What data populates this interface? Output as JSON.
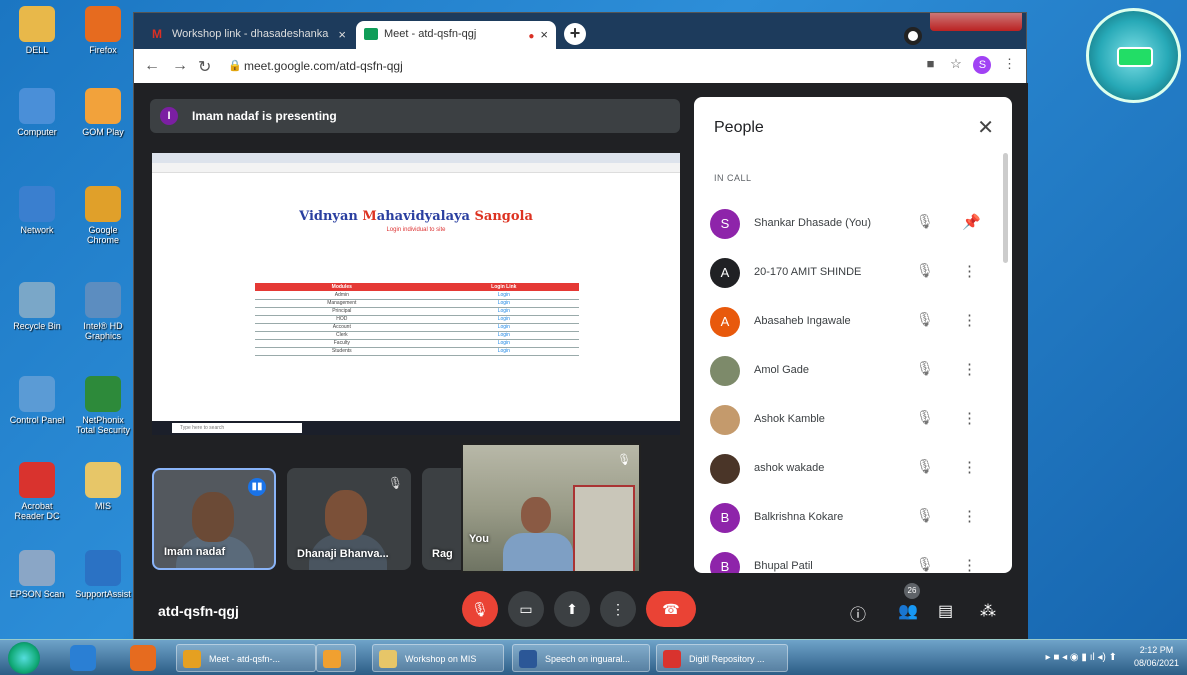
{
  "desktop_icons": [
    {
      "label": "DELL",
      "color": "#e8b84a"
    },
    {
      "label": "Firefox",
      "color": "#e66b1f"
    },
    {
      "label": "Computer",
      "color": "#4a8fd8"
    },
    {
      "label": "GOM Play",
      "color": "#f2a23b"
    },
    {
      "label": "Network",
      "color": "#3a7fcf"
    },
    {
      "label": "Google Chrome",
      "color": "#e0a02a"
    },
    {
      "label": "Recycle Bin",
      "color": "#7aa7c8"
    },
    {
      "label": "Intel® HD Graphics",
      "color": "#5c8dc0"
    },
    {
      "label": "Control Panel",
      "color": "#5b9bd5"
    },
    {
      "label": "NetPhonix Total Security",
      "color": "#2d8a3a"
    },
    {
      "label": "Acrobat Reader DC",
      "color": "#d9332e"
    },
    {
      "label": "MIS",
      "color": "#e7c668"
    },
    {
      "label": "EPSON Scan",
      "color": "#8aa6c6"
    },
    {
      "label": "SupportAssist",
      "color": "#2b72c4"
    }
  ],
  "browser": {
    "tabs": [
      {
        "label": "Workshop link - dhasadeshanka",
        "active": false,
        "favicon_color": "#d93025"
      },
      {
        "label": "Meet - atd-qsfn-qgj",
        "active": true,
        "favicon_color": "#0f9d58"
      }
    ],
    "new_tab_label": "+",
    "url": "meet.google.com/atd-qsfn-qgj",
    "profile_initial": "S"
  },
  "meet": {
    "presenting_text": "Imam nadaf is presenting",
    "presenter_initial": "I",
    "shared_screen": {
      "title_parts": [
        "Vidnyan ",
        "M",
        "ahavidyalaya ",
        "Sangola"
      ],
      "subtitle": "Login individual to site",
      "table_headers": [
        "Modules",
        "Login Link"
      ],
      "table_rows": [
        {
          "module": "Admin",
          "link": "Login"
        },
        {
          "module": "Management",
          "link": "Login"
        },
        {
          "module": "Principal",
          "link": "Login"
        },
        {
          "module": "HOD",
          "link": "Login"
        },
        {
          "module": "Account",
          "link": "Login"
        },
        {
          "module": "Clerk",
          "link": "Login"
        },
        {
          "module": "Faculty",
          "link": "Login"
        },
        {
          "module": "Students",
          "link": "Login"
        }
      ],
      "taskbar_search_placeholder": "Type here to search"
    },
    "tiles": [
      {
        "name": "Imam nadaf",
        "speaking": true
      },
      {
        "name": "Dhanaji Bhanva...",
        "speaking": false
      },
      {
        "name": "Rag",
        "speaking": false
      }
    ],
    "self_view_label": "You",
    "people_panel": {
      "title": "People",
      "section": "IN CALL",
      "participants": [
        {
          "name": "Shankar Dhasade (You)",
          "initial": "S",
          "color": "#8e24aa",
          "action": "pin"
        },
        {
          "name": "20-170 AMIT SHINDE",
          "initial": "A",
          "color": "#202124",
          "action": "more"
        },
        {
          "name": "Abasaheb Ingawale",
          "initial": "A",
          "color": "#e8590c",
          "action": "more"
        },
        {
          "name": "Amol Gade",
          "initial": "",
          "color": "#7d8a6a",
          "action": "more"
        },
        {
          "name": "Ashok Kamble",
          "initial": "",
          "color": "#c49a6c",
          "action": "more"
        },
        {
          "name": "ashok wakade",
          "initial": "",
          "color": "#4a3528",
          "action": "more"
        },
        {
          "name": "Balkrishna Kokare",
          "initial": "B",
          "color": "#8e24aa",
          "action": "more"
        },
        {
          "name": "Bhupal Patil",
          "initial": "B",
          "color": "#8e24aa",
          "action": "more"
        }
      ]
    },
    "meeting_code": "atd-qsfn-qgj",
    "participant_count": "26"
  },
  "taskbar": {
    "items": [
      {
        "label": "Meet - atd-qsfn-...",
        "color": "#e5a021"
      },
      {
        "label": "",
        "color": "#f0a030"
      },
      {
        "label": "Workshop on MIS",
        "color": "#e7c668"
      },
      {
        "label": "Speech on inguaral...",
        "color": "#2b5797"
      },
      {
        "label": "Digitl Repository ...",
        "color": "#d9332e"
      }
    ],
    "time": "2:12 PM",
    "date": "08/06/2021"
  }
}
